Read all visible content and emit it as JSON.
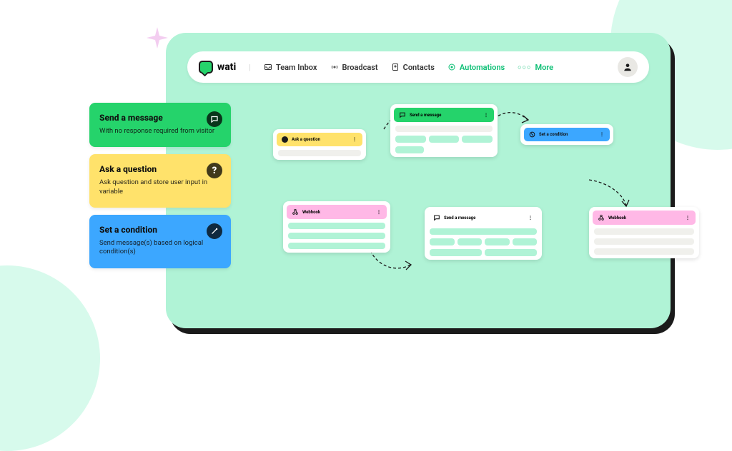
{
  "brand": "wati",
  "nav": {
    "team_inbox": "Team Inbox",
    "broadcast": "Broadcast",
    "contacts": "Contacts",
    "automations": "Automations",
    "more": "More"
  },
  "sidebar": {
    "send": {
      "title": "Send a message",
      "desc": "With no response required from visitor"
    },
    "ask": {
      "title": "Ask a question",
      "desc": "Ask question and store user input in variable"
    },
    "cond": {
      "title": "Set a condition",
      "desc": "Send message(s) based on logical condition(s)"
    }
  },
  "nodes": {
    "ask_q": "Ask a question",
    "send_msg": "Send a message",
    "set_cond": "Set a condition",
    "webhook": "Webhook"
  }
}
